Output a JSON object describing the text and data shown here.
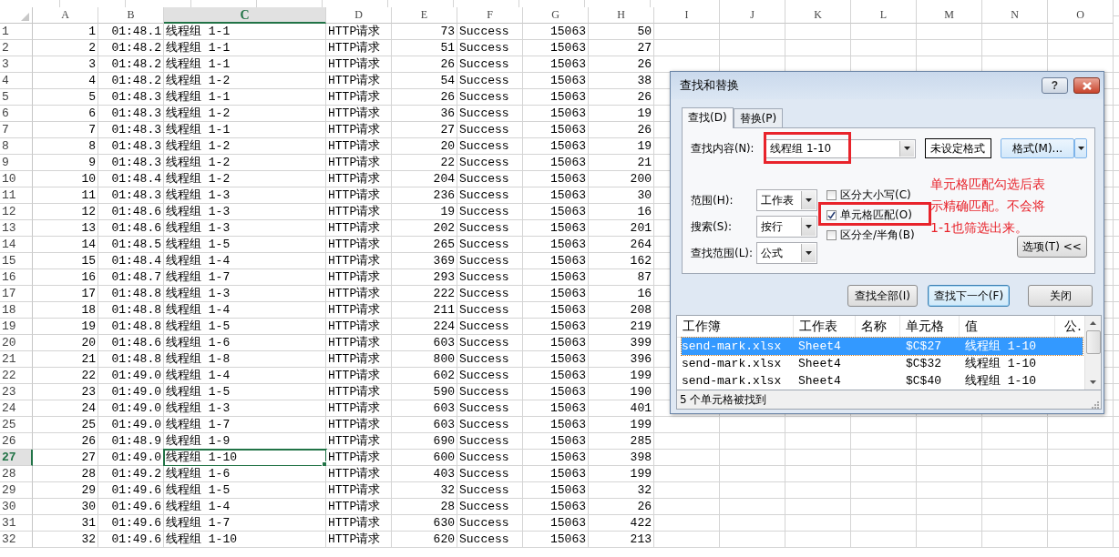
{
  "sheet": {
    "columns": [
      {
        "label": "A",
        "kind": "number",
        "selected": false
      },
      {
        "label": "B",
        "kind": "number",
        "selected": false
      },
      {
        "label": "C",
        "kind": "text",
        "selected": true
      },
      {
        "label": "D",
        "kind": "text",
        "selected": false
      },
      {
        "label": "E",
        "kind": "number",
        "selected": false
      },
      {
        "label": "F",
        "kind": "text",
        "selected": false
      },
      {
        "label": "G",
        "kind": "number",
        "selected": false
      },
      {
        "label": "H",
        "kind": "number",
        "selected": false
      },
      {
        "label": "I",
        "selected": false
      },
      {
        "label": "J",
        "selected": false
      },
      {
        "label": "K",
        "selected": false
      },
      {
        "label": "L",
        "selected": false
      },
      {
        "label": "M",
        "selected": false
      },
      {
        "label": "N",
        "selected": false
      },
      {
        "label": "O",
        "selected": false
      }
    ],
    "rows": [
      {
        "number": "1",
        "selected": false,
        "cells": [
          "1",
          "01:48.1",
          "线程组 1-1",
          "HTTP请求",
          "73",
          "Success",
          "15063",
          "50"
        ]
      },
      {
        "number": "2",
        "selected": false,
        "cells": [
          "2",
          "01:48.2",
          "线程组 1-1",
          "HTTP请求",
          "51",
          "Success",
          "15063",
          "27"
        ]
      },
      {
        "number": "3",
        "selected": false,
        "cells": [
          "3",
          "01:48.2",
          "线程组 1-1",
          "HTTP请求",
          "26",
          "Success",
          "15063",
          "26"
        ]
      },
      {
        "number": "4",
        "selected": false,
        "cells": [
          "4",
          "01:48.2",
          "线程组 1-2",
          "HTTP请求",
          "54",
          "Success",
          "15063",
          "38"
        ]
      },
      {
        "number": "5",
        "selected": false,
        "cells": [
          "5",
          "01:48.3",
          "线程组 1-1",
          "HTTP请求",
          "26",
          "Success",
          "15063",
          "26"
        ]
      },
      {
        "number": "6",
        "selected": false,
        "cells": [
          "6",
          "01:48.3",
          "线程组 1-2",
          "HTTP请求",
          "36",
          "Success",
          "15063",
          "19"
        ]
      },
      {
        "number": "7",
        "selected": false,
        "cells": [
          "7",
          "01:48.3",
          "线程组 1-1",
          "HTTP请求",
          "27",
          "Success",
          "15063",
          "26"
        ]
      },
      {
        "number": "8",
        "selected": false,
        "cells": [
          "8",
          "01:48.3",
          "线程组 1-2",
          "HTTP请求",
          "20",
          "Success",
          "15063",
          "19"
        ]
      },
      {
        "number": "9",
        "selected": false,
        "cells": [
          "9",
          "01:48.3",
          "线程组 1-2",
          "HTTP请求",
          "22",
          "Success",
          "15063",
          "21"
        ]
      },
      {
        "number": "10",
        "selected": false,
        "cells": [
          "10",
          "01:48.4",
          "线程组 1-2",
          "HTTP请求",
          "204",
          "Success",
          "15063",
          "200"
        ]
      },
      {
        "number": "11",
        "selected": false,
        "cells": [
          "11",
          "01:48.3",
          "线程组 1-3",
          "HTTP请求",
          "236",
          "Success",
          "15063",
          "30"
        ]
      },
      {
        "number": "12",
        "selected": false,
        "cells": [
          "12",
          "01:48.6",
          "线程组 1-3",
          "HTTP请求",
          "19",
          "Success",
          "15063",
          "16"
        ]
      },
      {
        "number": "13",
        "selected": false,
        "cells": [
          "13",
          "01:48.6",
          "线程组 1-3",
          "HTTP请求",
          "202",
          "Success",
          "15063",
          "201"
        ]
      },
      {
        "number": "14",
        "selected": false,
        "cells": [
          "14",
          "01:48.5",
          "线程组 1-5",
          "HTTP请求",
          "265",
          "Success",
          "15063",
          "264"
        ]
      },
      {
        "number": "15",
        "selected": false,
        "cells": [
          "15",
          "01:48.4",
          "线程组 1-4",
          "HTTP请求",
          "369",
          "Success",
          "15063",
          "162"
        ]
      },
      {
        "number": "16",
        "selected": false,
        "cells": [
          "16",
          "01:48.7",
          "线程组 1-7",
          "HTTP请求",
          "293",
          "Success",
          "15063",
          "87"
        ]
      },
      {
        "number": "17",
        "selected": false,
        "cells": [
          "17",
          "01:48.8",
          "线程组 1-3",
          "HTTP请求",
          "222",
          "Success",
          "15063",
          "16"
        ]
      },
      {
        "number": "18",
        "selected": false,
        "cells": [
          "18",
          "01:48.8",
          "线程组 1-4",
          "HTTP请求",
          "211",
          "Success",
          "15063",
          "208"
        ]
      },
      {
        "number": "19",
        "selected": false,
        "cells": [
          "19",
          "01:48.8",
          "线程组 1-5",
          "HTTP请求",
          "224",
          "Success",
          "15063",
          "219"
        ]
      },
      {
        "number": "20",
        "selected": false,
        "cells": [
          "20",
          "01:48.6",
          "线程组 1-6",
          "HTTP请求",
          "603",
          "Success",
          "15063",
          "399"
        ]
      },
      {
        "number": "21",
        "selected": false,
        "cells": [
          "21",
          "01:48.8",
          "线程组 1-8",
          "HTTP请求",
          "800",
          "Success",
          "15063",
          "396"
        ]
      },
      {
        "number": "22",
        "selected": false,
        "cells": [
          "22",
          "01:49.0",
          "线程组 1-4",
          "HTTP请求",
          "602",
          "Success",
          "15063",
          "199"
        ]
      },
      {
        "number": "23",
        "selected": false,
        "cells": [
          "23",
          "01:49.0",
          "线程组 1-5",
          "HTTP请求",
          "590",
          "Success",
          "15063",
          "190"
        ]
      },
      {
        "number": "24",
        "selected": false,
        "cells": [
          "24",
          "01:49.0",
          "线程组 1-3",
          "HTTP请求",
          "603",
          "Success",
          "15063",
          "401"
        ]
      },
      {
        "number": "25",
        "selected": false,
        "cells": [
          "25",
          "01:49.0",
          "线程组 1-7",
          "HTTP请求",
          "603",
          "Success",
          "15063",
          "199"
        ]
      },
      {
        "number": "26",
        "selected": false,
        "cells": [
          "26",
          "01:48.9",
          "线程组 1-9",
          "HTTP请求",
          "690",
          "Success",
          "15063",
          "285"
        ]
      },
      {
        "number": "27",
        "selected": true,
        "cells": [
          "27",
          "01:49.0",
          "线程组 1-10",
          "HTTP请求",
          "600",
          "Success",
          "15063",
          "398"
        ]
      },
      {
        "number": "28",
        "selected": false,
        "cells": [
          "28",
          "01:49.2",
          "线程组 1-6",
          "HTTP请求",
          "403",
          "Success",
          "15063",
          "199"
        ]
      },
      {
        "number": "29",
        "selected": false,
        "cells": [
          "29",
          "01:49.6",
          "线程组 1-5",
          "HTTP请求",
          "32",
          "Success",
          "15063",
          "32"
        ]
      },
      {
        "number": "30",
        "selected": false,
        "cells": [
          "30",
          "01:49.6",
          "线程组 1-4",
          "HTTP请求",
          "28",
          "Success",
          "15063",
          "26"
        ]
      },
      {
        "number": "31",
        "selected": false,
        "cells": [
          "31",
          "01:49.6",
          "线程组 1-7",
          "HTTP请求",
          "630",
          "Success",
          "15063",
          "422"
        ]
      },
      {
        "number": "32",
        "selected": false,
        "cells": [
          "32",
          "01:49.6",
          "线程组 1-10",
          "HTTP请求",
          "620",
          "Success",
          "15063",
          "213"
        ]
      }
    ]
  },
  "dialog": {
    "title": "查找和替换",
    "help_button": "?",
    "tabs": [
      {
        "label": "查找(D)",
        "selected": true
      },
      {
        "label": "替换(P)",
        "selected": false
      }
    ],
    "find_what": {
      "label": "查找内容(N):",
      "value": "线程组 1-10",
      "highlighted": true
    },
    "format_preview": "未设定格式",
    "format_button": "格式(M)...",
    "options": [
      {
        "label": "范围(H):",
        "value": "工作表"
      },
      {
        "label": "搜索(S):",
        "value": "按行"
      },
      {
        "label": "查找范围(L):",
        "value": "公式"
      }
    ],
    "checkboxes": [
      {
        "label": "区分大小写(C)",
        "checked": false,
        "highlighted": false
      },
      {
        "label": "单元格匹配(O)",
        "checked": true,
        "highlighted": true
      },
      {
        "label": "区分全/半角(B)",
        "checked": false,
        "highlighted": false
      }
    ],
    "annotation": "单元格匹配勾选后表示精确匹配。不会将1-1也筛选出来。",
    "options_button": "选项(T) <<",
    "buttons": [
      {
        "label": "查找全部(I)",
        "focused": false
      },
      {
        "label": "查找下一个(F)",
        "focused": true
      },
      {
        "label": "关闭",
        "focused": false
      }
    ],
    "results": {
      "columns": [
        "工作簿",
        "工作表",
        "名称",
        "单元格",
        "值",
        "公."
      ],
      "rows": [
        {
          "workbook": "send-mark.xlsx",
          "sheet": "Sheet4",
          "cell": "$C$27",
          "value": "线程组 1-10",
          "selected": true
        },
        {
          "workbook": "send-mark.xlsx",
          "sheet": "Sheet4",
          "cell": "$C$32",
          "value": "线程组 1-10",
          "selected": false
        },
        {
          "workbook": "send-mark.xlsx",
          "sheet": "Sheet4",
          "cell": "$C$40",
          "value": "线程组 1-10",
          "selected": false
        }
      ]
    },
    "status": "5 个单元格被找到"
  }
}
